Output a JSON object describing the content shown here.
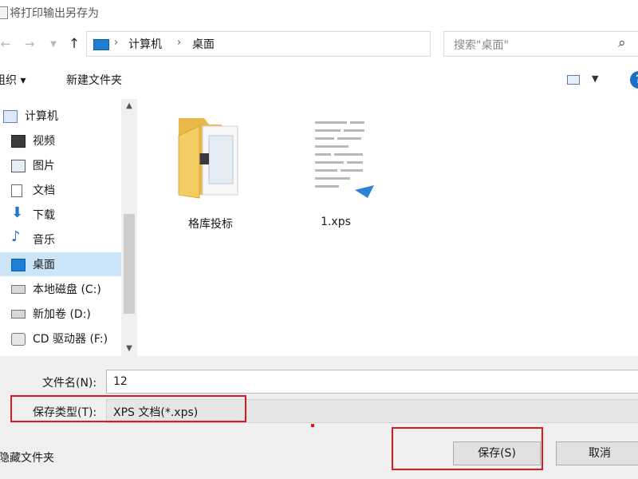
{
  "window": {
    "title": "将打印输出另存为"
  },
  "navigation": {
    "back_icon": "arrow-left-icon",
    "forward_icon": "arrow-right-icon",
    "history_icon": "chevron-down-icon",
    "up_icon": "arrow-up-icon",
    "breadcrumb": [
      "计算机",
      "桌面"
    ],
    "refresh_icon": "refresh-icon",
    "search_placeholder": "搜索\"桌面\""
  },
  "toolbar": {
    "organize_label": "组织 ▾",
    "new_folder_label": "新建文件夹"
  },
  "sidebar": {
    "items": [
      {
        "label": "计算机",
        "icon": "computer-icon",
        "selected": false
      },
      {
        "label": "视频",
        "icon": "video-icon",
        "selected": false
      },
      {
        "label": "图片",
        "icon": "picture-icon",
        "selected": false
      },
      {
        "label": "文档",
        "icon": "document-icon",
        "selected": false
      },
      {
        "label": "下载",
        "icon": "download-icon",
        "selected": false
      },
      {
        "label": "音乐",
        "icon": "music-icon",
        "selected": false
      },
      {
        "label": "桌面",
        "icon": "desktop-icon",
        "selected": true
      },
      {
        "label": "本地磁盘 (C:)",
        "icon": "drive-icon",
        "selected": false
      },
      {
        "label": "新加卷 (D:)",
        "icon": "drive-icon",
        "selected": false
      },
      {
        "label": "CD 驱动器 (F:)",
        "icon": "cd-drive-icon",
        "selected": false
      }
    ]
  },
  "files": [
    {
      "name": "格库投标",
      "type": "folder",
      "icon": "folder-icon"
    },
    {
      "name": "1.xps",
      "type": "xps",
      "icon": "xps-file-icon"
    }
  ],
  "form": {
    "filename_label": "文件名(N):",
    "filename_value": "12",
    "filetype_label": "保存类型(T):",
    "filetype_value": "XPS 文档(*.xps)"
  },
  "buttons": {
    "save": "保存(S)",
    "cancel": "取消",
    "hide_folders": "隐藏文件夹"
  },
  "colors": {
    "highlight": "#e1191f",
    "selection": "#cce4f7",
    "accent": "#1a6fc6"
  }
}
